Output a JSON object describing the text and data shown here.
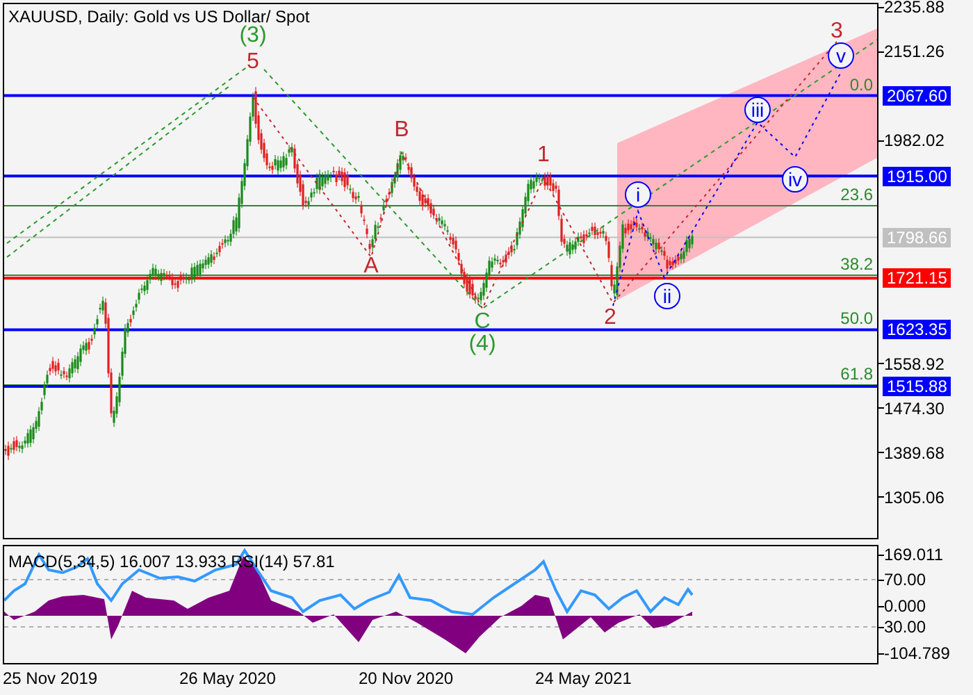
{
  "chart": {
    "title": "XAUUSD, Daily:  Gold vs US Dollar/ Spot",
    "price_ticks": [
      "2235.88",
      "2151.26",
      "1982.02",
      "1558.92",
      "1474.30",
      "1389.68",
      "1305.06"
    ],
    "price_levels": [
      {
        "label": "2067.60",
        "color": "#0000ff"
      },
      {
        "label": "1915.00",
        "color": "#0000ff"
      },
      {
        "label": "1798.66",
        "color": "#c0c0c0"
      },
      {
        "label": "1721.15",
        "color": "#ff0000"
      },
      {
        "label": "1623.35",
        "color": "#0000ff"
      },
      {
        "label": "1515.88",
        "color": "#0000ff"
      }
    ],
    "fib_levels": [
      "0.0",
      "23.6",
      "38.2",
      "50.0",
      "61.8"
    ],
    "wave_labels": [
      {
        "text": "(3)",
        "kind": "plain",
        "color": "#2a9a2a"
      },
      {
        "text": "5",
        "kind": "plain",
        "color": "#c0282d"
      },
      {
        "text": "B",
        "kind": "plain",
        "color": "#c0282d"
      },
      {
        "text": "A",
        "kind": "plain",
        "color": "#c0282d"
      },
      {
        "text": "C",
        "kind": "plain",
        "color": "#2a9a2a"
      },
      {
        "text": "(4)",
        "kind": "plain",
        "color": "#2a9a2a"
      },
      {
        "text": "1",
        "kind": "plain",
        "color": "#c0282d"
      },
      {
        "text": "2",
        "kind": "plain",
        "color": "#c0282d"
      },
      {
        "text": "3",
        "kind": "plain",
        "color": "#c0282d"
      },
      {
        "text": "i",
        "kind": "circled",
        "color": "#0000ff"
      },
      {
        "text": "ii",
        "kind": "circled",
        "color": "#0000ff"
      },
      {
        "text": "iii",
        "kind": "circled",
        "color": "#0000ff"
      },
      {
        "text": "iv",
        "kind": "circled",
        "color": "#0000ff"
      },
      {
        "text": "v",
        "kind": "circled",
        "color": "#0000ff"
      }
    ]
  },
  "indicator": {
    "label": "MACD(5,34,5) 16.007 13.933 RSI(14) 57.81",
    "ticks": [
      "169.011",
      "70.00",
      "0.000",
      "30.00",
      "-104.789"
    ]
  },
  "x_axis": {
    "labels": [
      "25 Nov 2019",
      "26 May 2020",
      "20 Nov 2020",
      "24 May 2021"
    ]
  }
}
